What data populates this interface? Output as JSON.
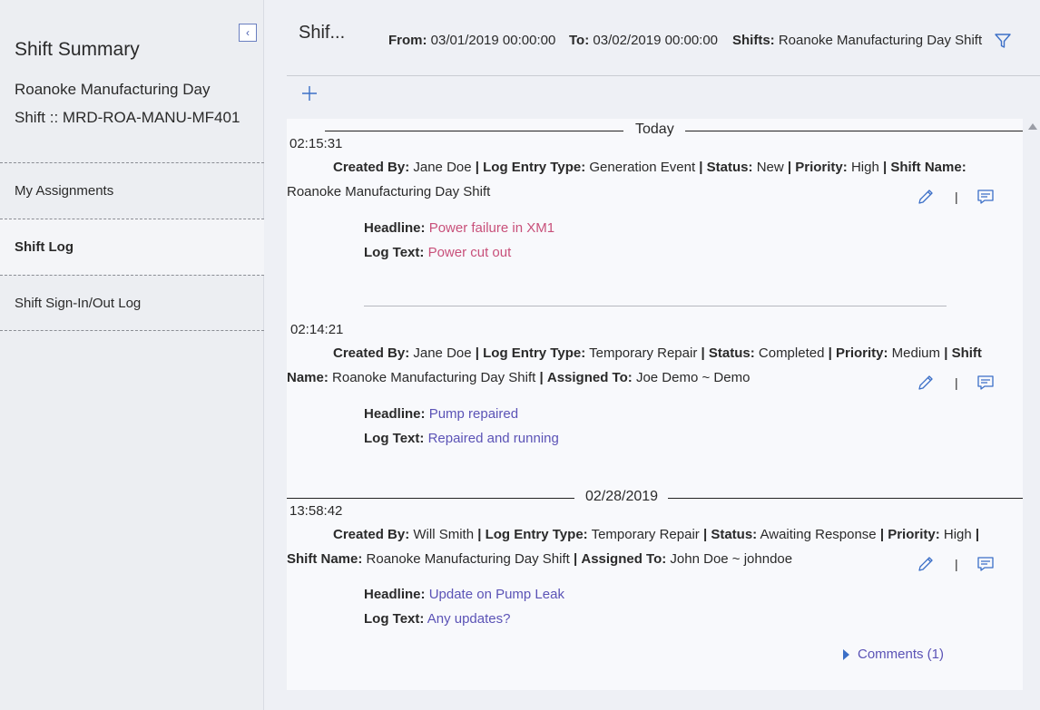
{
  "sidebar": {
    "title": "Shift Summary",
    "subtitle_line1": "Roanoke Manufacturing Day",
    "subtitle_line2": "Shift :: MRD-ROA-MANU-MF401",
    "collapse_glyph": "‹",
    "nav": [
      {
        "label": "My Assignments"
      },
      {
        "label": "Shift Log"
      },
      {
        "label": "Shift Sign-In/Out Log"
      }
    ]
  },
  "header": {
    "title": "Shif...",
    "from_label": "From:",
    "from_value": "03/01/2019 00:00:00",
    "to_label": "To:",
    "to_value": "03/02/2019 00:00:00",
    "shifts_label": "Shifts:",
    "shifts_value": "Roanoke Manufacturing Day Shift"
  },
  "feed": {
    "dividers": [
      "Today",
      "02/28/2019"
    ],
    "entries": [
      {
        "time": "02:15:31",
        "created_by": "Jane Doe",
        "log_entry_type": "Generation Event",
        "status": "New",
        "priority": "High",
        "shift_name": "Roanoke Manufacturing Day Shift",
        "headline": "Power failure in XM1",
        "log_text": "Power cut out"
      },
      {
        "time": "02:14:21",
        "created_by": "Jane Doe",
        "log_entry_type": "Temporary Repair",
        "status": "Completed",
        "priority": "Medium",
        "shift_name": "Roanoke Manufacturing Day Shift",
        "assigned_to": "Joe Demo ~ Demo",
        "headline": "Pump repaired",
        "log_text": "Repaired and running"
      },
      {
        "time": "13:58:42",
        "created_by": "Will Smith",
        "log_entry_type": "Temporary Repair",
        "status": "Awaiting Response",
        "priority": "High",
        "shift_name": "Roanoke Manufacturing Day Shift",
        "assigned_to": "John Doe ~ johndoe",
        "headline": "Update on Pump Leak",
        "log_text": "Any updates?",
        "comments": "Comments (1)"
      }
    ]
  },
  "labels": {
    "created_by": "Created By:",
    "log_entry_type": "Log Entry Type:",
    "status": "Status:",
    "priority": "Priority:",
    "shift_name": "Shift Name:",
    "assigned_to": "Assigned To:",
    "headline": "Headline:",
    "log_text": "Log Text:",
    "pipe": "|"
  },
  "icons": {
    "collapse": "chevron-left-icon",
    "filter": "filter-icon",
    "add": "plus-icon",
    "edit": "pencil-icon",
    "comment": "comment-icon"
  },
  "colors": {
    "accent": "#3b6fc7",
    "headline_new": "#c8507a",
    "headline_default": "#5b53b6"
  }
}
